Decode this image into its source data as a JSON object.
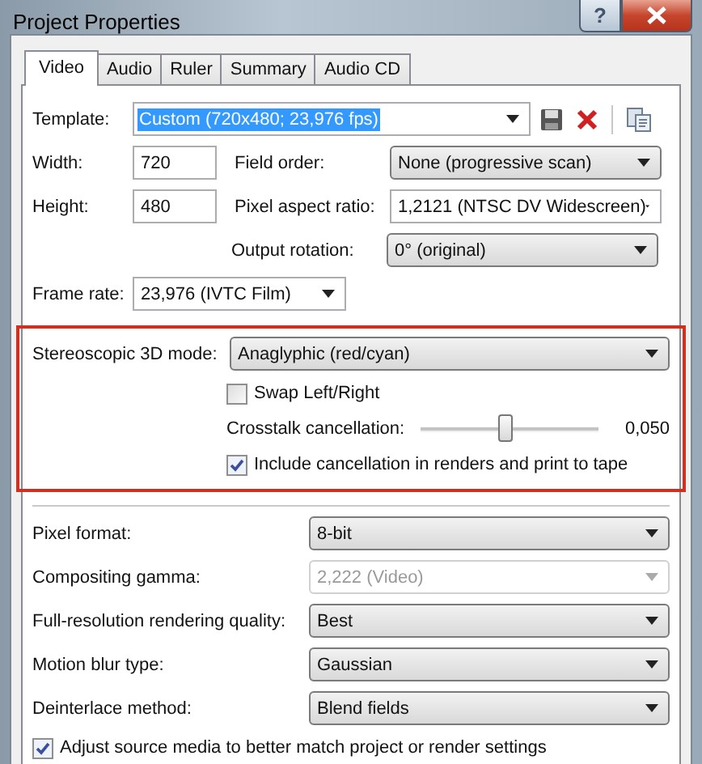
{
  "window": {
    "title": "Project Properties"
  },
  "title_buttons": [
    {
      "kind": "help",
      "label": "?"
    },
    {
      "kind": "close"
    }
  ],
  "tabs": [
    {
      "label": "Video",
      "selected": true
    },
    {
      "label": "Audio",
      "selected": false
    },
    {
      "label": "Ruler",
      "selected": false
    },
    {
      "label": "Summary",
      "selected": false
    },
    {
      "label": "Audio CD",
      "selected": false
    }
  ],
  "template": {
    "label": "Template:",
    "value": "Custom (720x480; 23,976 fps)",
    "highlighted": true
  },
  "width": {
    "label": "Width:",
    "value": "720"
  },
  "height": {
    "label": "Height:",
    "value": "480"
  },
  "field_order": {
    "label": "Field order:",
    "value": "None (progressive scan)"
  },
  "pixel_aspect_ratio": {
    "label": "Pixel aspect ratio:",
    "value": "1,2121 (NTSC DV Widescreen)"
  },
  "output_rotation": {
    "label": "Output rotation:",
    "value": "0° (original)"
  },
  "frame_rate": {
    "label": "Frame rate:",
    "value": "23,976 (IVTC Film)"
  },
  "stereoscopic": {
    "mode": {
      "label": "Stereoscopic 3D mode:",
      "value": "Anaglyphic (red/cyan)"
    },
    "swap": {
      "label": "Swap Left/Right",
      "checked": false
    },
    "crosstalk": {
      "label": "Crosstalk cancellation:",
      "level": 0.48,
      "reading": "0,050"
    },
    "include": {
      "label": "Include cancellation in renders and print to tape",
      "checked": true
    }
  },
  "settings": [
    {
      "label": "Pixel format:",
      "value": "8-bit",
      "disabled": false
    },
    {
      "label": "Compositing gamma:",
      "value": "2,222 (Video)",
      "disabled": true
    },
    {
      "label": "Full-resolution rendering quality:",
      "value": "Best",
      "disabled": false
    },
    {
      "label": "Motion blur type:",
      "value": "Gaussian",
      "disabled": false
    },
    {
      "label": "Deinterlace method:",
      "value": "Blend fields",
      "disabled": false
    }
  ],
  "adjust_source": {
    "label": "Adjust source media to better match project or render settings",
    "checked": true
  }
}
